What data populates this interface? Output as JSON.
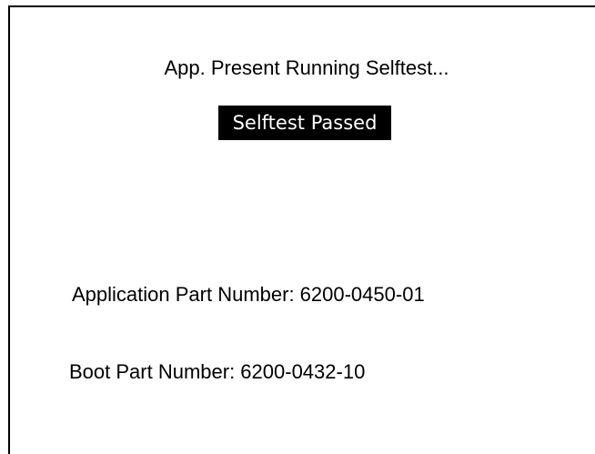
{
  "status": {
    "message": "App. Present Running Selftest...",
    "result": "Selftest Passed"
  },
  "part_numbers": {
    "application": "Application Part Number: 6200-0450-01",
    "boot": "Boot Part Number: 6200-0432-10"
  },
  "colors": {
    "background": "#ffffff",
    "foreground": "#000000",
    "badge_background": "#000000",
    "badge_text": "#ffffff"
  }
}
